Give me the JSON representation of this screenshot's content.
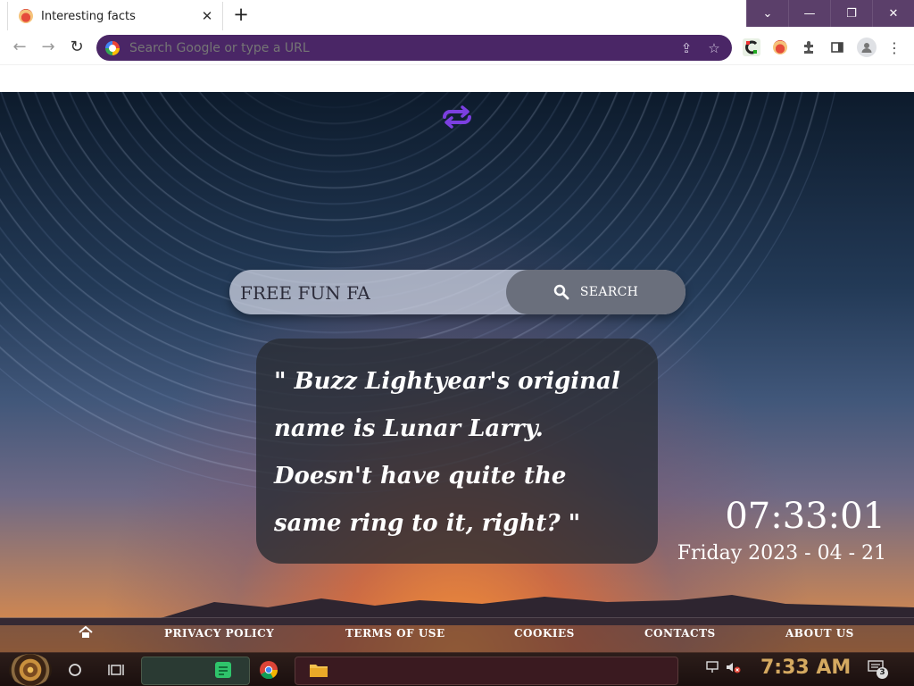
{
  "browser": {
    "tab_title": "Interesting facts",
    "tab_close": "✕",
    "new_tab": "+",
    "omnibox_placeholder": "Search Google or type a URL",
    "window_controls": [
      "⌄",
      "—",
      "❐",
      "✕"
    ]
  },
  "page": {
    "search": {
      "value": "FREE FUN FA",
      "button_label": "SEARCH"
    },
    "fact": {
      "text": "\"  Buzz Lightyear's original name is Lunar Larry. Doesn't have quite the same ring to it, right?  \""
    },
    "clock": {
      "time": "07:33:01",
      "date": "Friday 2023 - 04 - 21"
    },
    "footer": {
      "links": [
        "PRIVACY POLICY",
        "TERMS OF USE",
        "COOKIES",
        "CONTACTS",
        "ABOUT US"
      ]
    }
  },
  "taskbar": {
    "time": "7:33 AM",
    "notification_count": "3"
  },
  "icons": {
    "repeat": "repeat-icon",
    "search": "search-icon",
    "home": "home-icon"
  },
  "colors": {
    "omnibox_bg": "#4a2666",
    "window_controls_bg": "#5b3f6a",
    "repeat_icon": "#7b3fe0",
    "search_button_bg": "#6a6f7c",
    "fact_card_bg": "rgba(40,43,50,0.78)",
    "taskbar_clock": "#d4a960"
  }
}
